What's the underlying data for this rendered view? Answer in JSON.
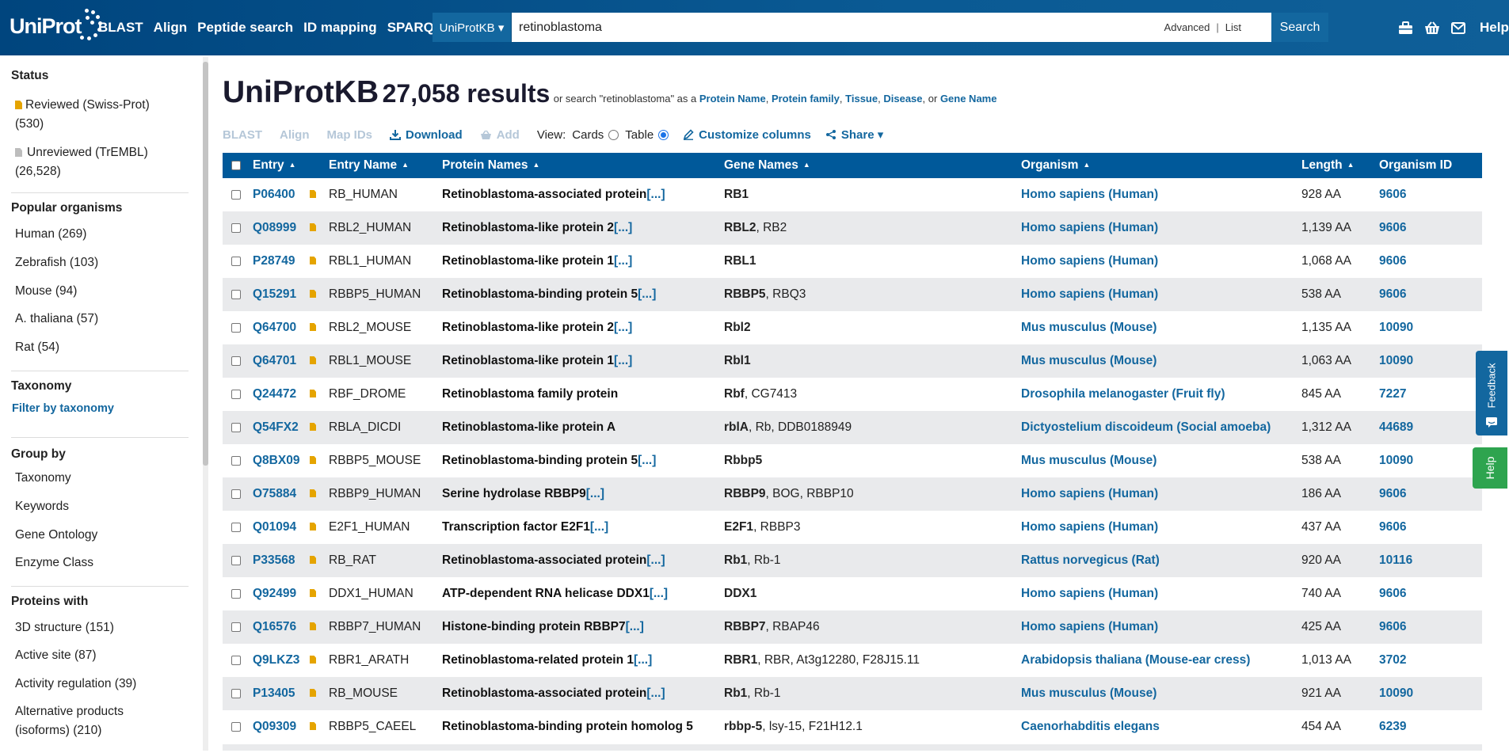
{
  "header": {
    "logo": "UniProt",
    "nav": [
      "BLAST",
      "Align",
      "Peptide search",
      "ID mapping",
      "SPARQL"
    ],
    "db_select": "UniProtKB ▾",
    "query": "retinoblastoma",
    "advanced": "Advanced",
    "list": "List",
    "search_button": "Search",
    "help": "Help",
    "icons": [
      "toolkit-icon",
      "basket-icon",
      "mail-icon"
    ]
  },
  "sidebar": {
    "status_heading": "Status",
    "reviewed_label": "Reviewed (Swiss-Prot)",
    "reviewed_count": "(530)",
    "unreviewed_label": "Unreviewed (TrEMBL)",
    "unreviewed_count": "(26,528)",
    "organisms_heading": "Popular organisms",
    "organisms": [
      "Human (269)",
      "Zebrafish (103)",
      "Mouse (94)",
      "A. thaliana (57)",
      "Rat (54)"
    ],
    "taxonomy_heading": "Taxonomy",
    "taxonomy_link": "Filter by taxonomy",
    "groupby_heading": "Group by",
    "groupby": [
      "Taxonomy",
      "Keywords",
      "Gene Ontology",
      "Enzyme Class"
    ],
    "proteins_heading": "Proteins with",
    "proteins": [
      "3D structure (151)",
      "Active site (87)",
      "Activity regulation (39)"
    ],
    "alt_products_1": "Alternative products",
    "alt_products_2": "(isoforms) (210)"
  },
  "main": {
    "db": "UniProtKB",
    "count": "27,058 results",
    "alt_prefix": "or search \"retinoblastoma\" as a",
    "alt_links": [
      "Protein Name",
      "Protein family",
      "Tissue",
      "Disease",
      "Gene Name"
    ],
    "alt_sep1": ",",
    "alt_or": ", or",
    "toolbar": {
      "blast": "BLAST",
      "align": "Align",
      "mapids": "Map IDs",
      "download": "Download",
      "add": "Add",
      "view": "View:",
      "cards": "Cards",
      "table": "Table",
      "customize": "Customize columns",
      "share": "Share ▾"
    },
    "columns": [
      "Entry",
      "Entry Name",
      "Protein Names",
      "Gene Names",
      "Organism",
      "Length",
      "Organism ID"
    ],
    "more": "[...]",
    "rows": [
      {
        "entry": "P06400",
        "name": "RB_HUMAN",
        "protein": "Retinoblastoma-associated protein",
        "more": true,
        "gene": "RB1",
        "gene_alt": "",
        "organism": "Homo sapiens (Human)",
        "length": "928 AA",
        "orgid": "9606"
      },
      {
        "entry": "Q08999",
        "name": "RBL2_HUMAN",
        "protein": "Retinoblastoma-like protein 2",
        "more": true,
        "gene": "RBL2",
        "gene_alt": ", RB2",
        "organism": "Homo sapiens (Human)",
        "length": "1,139 AA",
        "orgid": "9606"
      },
      {
        "entry": "P28749",
        "name": "RBL1_HUMAN",
        "protein": "Retinoblastoma-like protein 1",
        "more": true,
        "gene": "RBL1",
        "gene_alt": "",
        "organism": "Homo sapiens (Human)",
        "length": "1,068 AA",
        "orgid": "9606"
      },
      {
        "entry": "Q15291",
        "name": "RBBP5_HUMAN",
        "protein": "Retinoblastoma-binding protein 5",
        "more": true,
        "gene": "RBBP5",
        "gene_alt": ", RBQ3",
        "organism": "Homo sapiens (Human)",
        "length": "538 AA",
        "orgid": "9606"
      },
      {
        "entry": "Q64700",
        "name": "RBL2_MOUSE",
        "protein": "Retinoblastoma-like protein 2",
        "more": true,
        "gene": "Rbl2",
        "gene_alt": "",
        "organism": "Mus musculus (Mouse)",
        "length": "1,135 AA",
        "orgid": "10090"
      },
      {
        "entry": "Q64701",
        "name": "RBL1_MOUSE",
        "protein": "Retinoblastoma-like protein 1",
        "more": true,
        "gene": "Rbl1",
        "gene_alt": "",
        "organism": "Mus musculus (Mouse)",
        "length": "1,063 AA",
        "orgid": "10090"
      },
      {
        "entry": "Q24472",
        "name": "RBF_DROME",
        "protein": "Retinoblastoma family protein",
        "more": false,
        "gene": "Rbf",
        "gene_alt": ", CG7413",
        "organism": "Drosophila melanogaster (Fruit fly)",
        "length": "845 AA",
        "orgid": "7227"
      },
      {
        "entry": "Q54FX2",
        "name": "RBLA_DICDI",
        "protein": "Retinoblastoma-like protein A",
        "more": false,
        "gene": "rblA",
        "gene_alt": ", Rb, DDB0188949",
        "organism": "Dictyostelium discoideum (Social amoeba)",
        "length": "1,312 AA",
        "orgid": "44689"
      },
      {
        "entry": "Q8BX09",
        "name": "RBBP5_MOUSE",
        "protein": "Retinoblastoma-binding protein 5",
        "more": true,
        "gene": "Rbbp5",
        "gene_alt": "",
        "organism": "Mus musculus (Mouse)",
        "length": "538 AA",
        "orgid": "10090"
      },
      {
        "entry": "O75884",
        "name": "RBBP9_HUMAN",
        "protein": "Serine hydrolase RBBP9",
        "more": true,
        "gene": "RBBP9",
        "gene_alt": ", BOG, RBBP10",
        "organism": "Homo sapiens (Human)",
        "length": "186 AA",
        "orgid": "9606"
      },
      {
        "entry": "Q01094",
        "name": "E2F1_HUMAN",
        "protein": "Transcription factor E2F1",
        "more": true,
        "gene": "E2F1",
        "gene_alt": ", RBBP3",
        "organism": "Homo sapiens (Human)",
        "length": "437 AA",
        "orgid": "9606"
      },
      {
        "entry": "P33568",
        "name": "RB_RAT",
        "protein": "Retinoblastoma-associated protein",
        "more": true,
        "gene": "Rb1",
        "gene_alt": ", Rb-1",
        "organism": "Rattus norvegicus (Rat)",
        "length": "920 AA",
        "orgid": "10116"
      },
      {
        "entry": "Q92499",
        "name": "DDX1_HUMAN",
        "protein": "ATP-dependent RNA helicase DDX1",
        "more": true,
        "gene": "DDX1",
        "gene_alt": "",
        "organism": "Homo sapiens (Human)",
        "length": "740 AA",
        "orgid": "9606"
      },
      {
        "entry": "Q16576",
        "name": "RBBP7_HUMAN",
        "protein": "Histone-binding protein RBBP7",
        "more": true,
        "gene": "RBBP7",
        "gene_alt": ", RBAP46",
        "organism": "Homo sapiens (Human)",
        "length": "425 AA",
        "orgid": "9606"
      },
      {
        "entry": "Q9LKZ3",
        "name": "RBR1_ARATH",
        "protein": "Retinoblastoma-related protein 1",
        "more": true,
        "gene": "RBR1",
        "gene_alt": ", RBR, At3g12280, F28J15.11",
        "organism": "Arabidopsis thaliana (Mouse-ear cress)",
        "length": "1,013 AA",
        "orgid": "3702"
      },
      {
        "entry": "P13405",
        "name": "RB_MOUSE",
        "protein": "Retinoblastoma-associated protein",
        "more": true,
        "gene": "Rb1",
        "gene_alt": ", Rb-1",
        "organism": "Mus musculus (Mouse)",
        "length": "921 AA",
        "orgid": "10090"
      },
      {
        "entry": "Q09309",
        "name": "RBBP5_CAEEL",
        "protein": "Retinoblastoma-binding protein homolog 5",
        "more": false,
        "gene": "rbbp-5",
        "gene_alt": ", lsy-15, F21H12.1",
        "organism": "Caenorhabditis elegans",
        "length": "454 AA",
        "orgid": "6239"
      }
    ]
  },
  "floating": {
    "feedback": "Feedback",
    "help": "Help"
  },
  "colors": {
    "header": "#00457e",
    "link": "#13679f",
    "table_header": "#00599a",
    "reviewed": "#e5a400",
    "help_tab": "#2ea44f"
  }
}
